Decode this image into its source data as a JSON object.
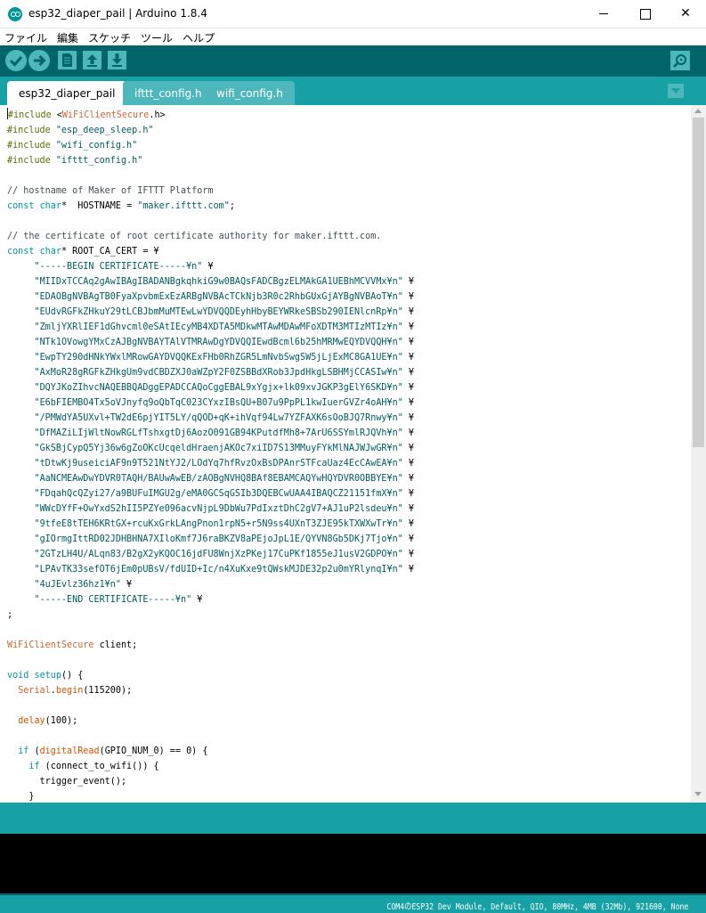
{
  "window": {
    "title": "esp32_diaper_pail | Arduino 1.8.4",
    "minimize_label": "—",
    "maximize_label": "☐",
    "close_label": "✕"
  },
  "menu": {
    "items": [
      "ファイル",
      "編集",
      "スケッチ",
      "ツール",
      "ヘルプ"
    ]
  },
  "toolbar": {
    "buttons": [
      {
        "name": "verify",
        "icon": "check-icon"
      },
      {
        "name": "upload",
        "icon": "arrow-right-icon"
      },
      {
        "name": "new",
        "icon": "document-icon"
      },
      {
        "name": "open",
        "icon": "arrow-up-icon"
      },
      {
        "name": "save",
        "icon": "arrow-down-icon"
      },
      {
        "name": "serial-monitor",
        "icon": "magnifier-icon"
      }
    ]
  },
  "tabs": [
    {
      "label": "esp32_diaper_pail",
      "active": true
    },
    {
      "label": "ifttt_config.h",
      "active": false
    },
    {
      "label": "wifi_config.h",
      "active": false
    }
  ],
  "code": {
    "lines": [
      "#include <WiFiClientSecure.h>",
      "#include \"esp_deep_sleep.h\"",
      "#include \"wifi_config.h\"",
      "#include \"ifttt_config.h\"",
      "",
      "// hostname of Maker of IFTTT Platform",
      "const char*  HOSTNAME = \"maker.ifttt.com\";",
      "",
      "// the certificate of root certificate authority for maker.ifttt.com.",
      "const char* ROOT_CA_CERT = ¥",
      "     \"-----BEGIN CERTIFICATE-----¥n\" ¥",
      "     \"MIIDxTCCAq2gAwIBAgIBADANBgkqhkiG9w0BAQsFADCBgzELMAkGA1UEBhMCVVMx¥n\" ¥",
      "     \"EDAOBgNVBAgTB0FyaXpvbmExEzARBgNVBAcTCkNjb3R0c2RhbGUxGjAYBgNVBAoT¥n\" ¥",
      "     \"EUdvRGFkZHkuY29tLCBJbmMuMTEwLwYDVQQDEyhHbyBEYWRkeSBSb290IENlcnRp¥n\" ¥",
      "     \"ZmljYXRlIEF1dGhvcml0eSAtIEcyMB4XDTA5MDkwMTAwMDAwMFoXDTM3MTIzMTIz¥n\" ¥",
      "     \"NTk1OVowgYMxCzAJBgNVBAYTAlVTMRAwDgYDVQQIEwdBcml6b25hMRMwEQYDVQQH¥n\" ¥",
      "     \"EwpTY290dHNkYWxlMRowGAYDVQQKExFHb0RhZGR5LmNvbSwgSW5jLjExMC8GA1UE¥n\" ¥",
      "     \"AxMoR28gRGFkZHkgUm9vdCBDZXJ0aWZpY2F0ZSBBdXRob3JpdHkgLSBHMjCCASIw¥n\" ¥",
      "     \"DQYJKoZIhvcNAQEBBQADggEPADCCAQoCggEBAL9xYgjx+lk09xvJGKP3gElY6SKD¥n\" ¥",
      "     \"E6bFIEMBO4Tx5oVJnyfq9oQbTqC023CYxzIBsQU+B07u9PpPL1kwIuerGVZr4oAH¥n\" ¥",
      "     \"/PMWdYA5UXvl+TW2dE6pjYIT5LY/qQOD+qK+ihVqf94Lw7YZFAXK6sOoBJQ7Rnwy¥n\" ¥",
      "     \"DfMAZiLIjWltNowRGLfTshxgtDj6AozO091GB94KPutdfMh8+7ArU6SSYmlRJQVh¥n\" ¥",
      "     \"GkSBjCypQ5Yj36w6gZoOKcUcqeldHraenjAKOc7xiID7S13MMuyFYkMlNAJWJwGR¥n\" ¥",
      "     \"tDtwKj9useiciAF9n9T521NtYJ2/LOdYq7hfRvzOxBsDPAnrSTFcaUaz4EcCAwEA¥n\" ¥",
      "     \"AaNCMEAwDwYDVR0TAQH/BAUwAwEB/zAOBgNVHQ8BAf8EBAMCAQYwHQYDVR0OBBYE¥n\" ¥",
      "     \"FDqahQcQZyi27/a9BUFuIMGU2g/eMA0GCSqGSIb3DQEBCwUAA4IBAQCZ21151fmX¥n\" ¥",
      "     \"WWcDYfF+OwYxdS2hII5PZYe096acvNjpL9DbWu7PdIxztDhC2gV7+AJ1uP2lsdeu¥n\" ¥",
      "     \"9tfeE8tTEH6KRtGX+rcuKxGrkLAngPnon1rpN5+r5N9ss4UXnT3ZJE95kTXWXwTr¥n\" ¥",
      "     \"gIOrmgIttRD02JDHBHNA7XIloKmf7J6raBKZV8aPEjoJpL1E/QYVN8Gb5DKj7Tjo¥n\" ¥",
      "     \"2GTzLH4U/ALqn83/B2gX2yKQOC16jdFU8WnjXzPKej17CuPKf1855eJ1usV2GDPO¥n\" ¥",
      "     \"LPAvTK33sefOT6jEm0pUBsV/fdUID+Ic/n4XuKxe9tQWskMJDE32p2u0mYRlynqI¥n\" ¥",
      "     \"4uJEvlz36hz1¥n\" ¥",
      "     \"-----END CERTIFICATE-----¥n\" ¥",
      ";",
      "",
      "WiFiClientSecure client;",
      "",
      "void setup() {",
      "  Serial.begin(115200);",
      "",
      "  delay(100);",
      "",
      "  if (digitalRead(GPIO_NUM_0) == 0) {",
      "    if (connect_to_wifi()) {",
      "      trigger_event();",
      "    }"
    ]
  },
  "status": {
    "board_info": "COM4のESP32 Dev Module, Default, QIO, 80MHz, 4MB (32Mb), 921600, None"
  }
}
